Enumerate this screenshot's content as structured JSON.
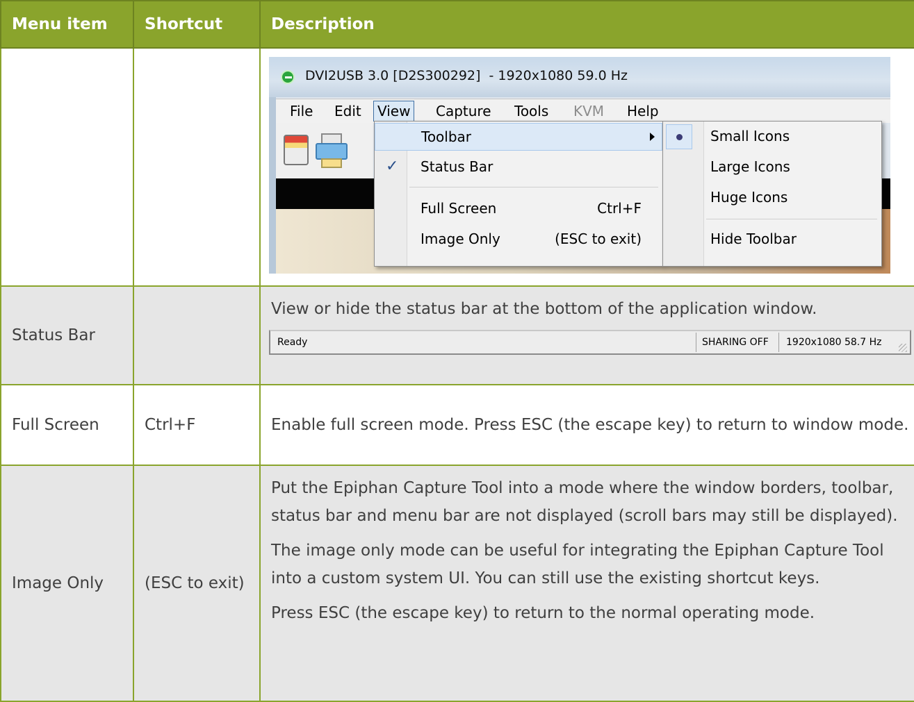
{
  "table": {
    "headers": [
      "Menu item",
      "Shortcut",
      "Description"
    ]
  },
  "screenshot_menu": {
    "window_title": "DVI2USB 3.0 [D2S300292]  - 1920x1080 59.0 Hz",
    "menubar": [
      "File",
      "Edit",
      "View",
      "Capture",
      "Tools",
      "KVM",
      "Help"
    ],
    "view_menu": {
      "toolbar": "Toolbar",
      "status_bar": "Status Bar",
      "full_screen": "Full Screen",
      "full_screen_shortcut": "Ctrl+F",
      "image_only": "Image Only",
      "image_only_shortcut": "(ESC to exit)"
    },
    "toolbar_submenu": [
      "Small Icons",
      "Large Icons",
      "Huge Icons",
      "Hide Toolbar"
    ]
  },
  "rows": [
    {
      "item": "Status Bar",
      "shortcut": "",
      "description": "View or hide the status bar at the bottom of the application window.",
      "statusbar": {
        "left": "Ready",
        "sharing": "SHARING OFF",
        "resolution": "1920x1080 58.7 Hz"
      }
    },
    {
      "item": "Full Screen",
      "shortcut": "Ctrl+F",
      "description": "Enable full screen mode. Press ESC (the escape key) to return to window mode."
    },
    {
      "item": "Image Only",
      "shortcut": "(ESC to exit)",
      "paragraphs": [
        "Put the Epiphan Capture Tool into a mode where the window borders, toolbar, status bar and menu bar are not displayed (scroll bars may still be displayed).",
        "The image only mode can be useful for integrating the Epiphan Capture Tool into a custom system UI. You can still use the existing shortcut keys.",
        "Press ESC (the escape key) to return to the normal operating mode."
      ]
    }
  ]
}
